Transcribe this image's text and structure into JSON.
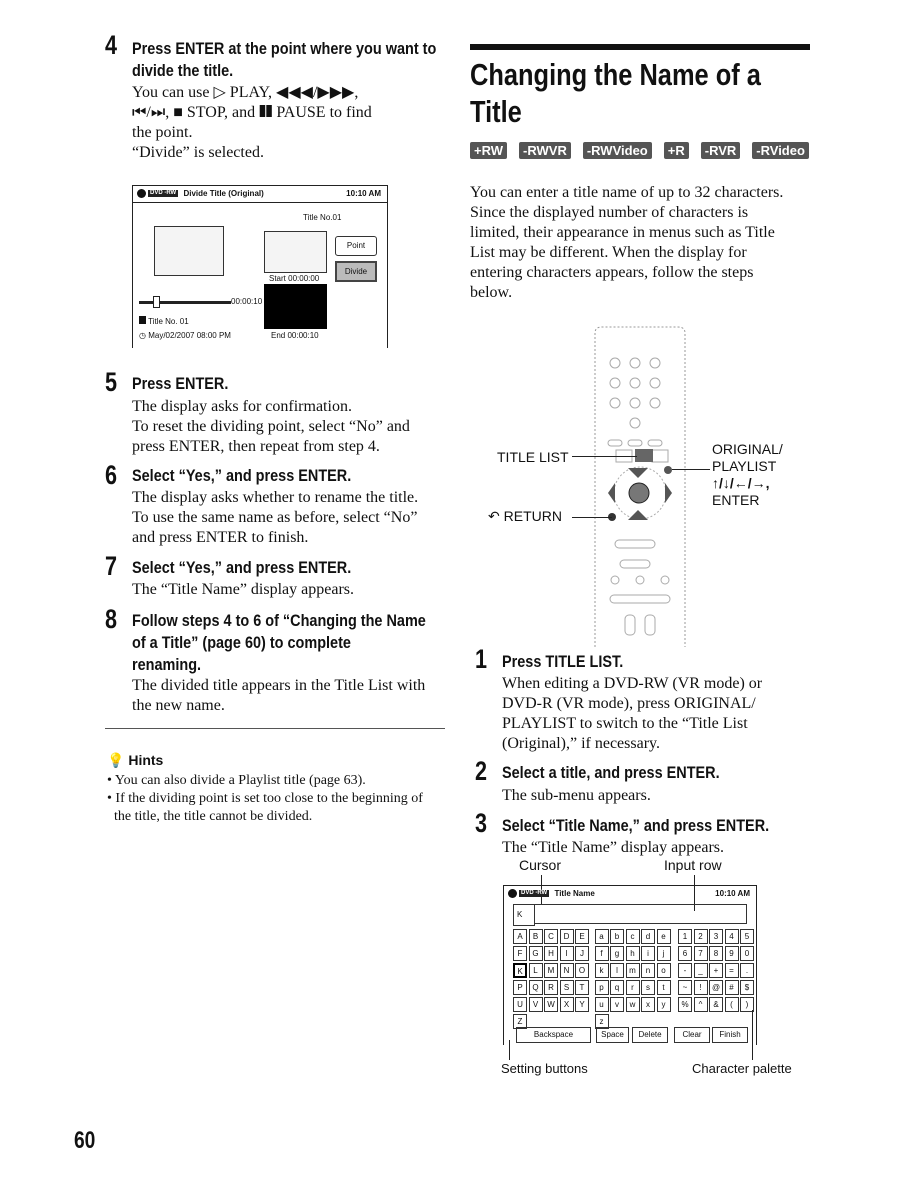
{
  "left": {
    "step4": {
      "num": "4",
      "heading1": "Press ENTER at the point where you want to",
      "heading2": "divide the title.",
      "body1": "You can use ▷ PLAY, ◀◀◀/▶▶▶,",
      "body2": "⏮/⏭, ■ STOP, and ❚❚ PAUSE to find",
      "body3": "the point.",
      "body4": "“Divide” is selected."
    },
    "screen": {
      "title": "Divide Title (Original)",
      "time": "10:10 AM",
      "disc": "DVD -RW",
      "title_no": "Title No.01",
      "point": "Point",
      "divide": "Divide",
      "start": "Start 00:00:00",
      "end": "End  00:00:10",
      "progress_time": "00:00:10",
      "title_label": "Title No. 01",
      "date": "May/02/2007  08:00  PM"
    },
    "step5": {
      "num": "5",
      "heading": "Press ENTER.",
      "body": [
        "The display asks for confirmation.",
        "To reset the dividing point, select “No” and",
        "press ENTER, then repeat from step 4."
      ]
    },
    "step6": {
      "num": "6",
      "heading": "Select “Yes,” and press ENTER.",
      "body": [
        "The display asks whether to rename the title.",
        "To use the same name as before, select “No”",
        "and press ENTER to finish."
      ]
    },
    "step7": {
      "num": "7",
      "heading": "Select “Yes,” and press ENTER.",
      "body": [
        "The “Title Name” display appears."
      ]
    },
    "step8": {
      "num": "8",
      "heading": [
        "Follow steps 4 to 6 of “Changing the Name",
        "of a Title” (page 60) to complete",
        "renaming."
      ],
      "body": [
        "The divided title appears in the Title List with",
        "the new name."
      ]
    },
    "hints": {
      "title": "Hints",
      "items": [
        "• You can also divide a Playlist title (page 63).",
        "• If the dividing point is set too close to the beginning of",
        "  the title, the title cannot be divided."
      ]
    }
  },
  "right": {
    "title1": "Changing the Name of a",
    "title2": "Title",
    "badges": [
      "+RW",
      "-RWVR",
      "-RWVideo",
      "+R",
      "-RVR",
      "-RVideo"
    ],
    "intro": [
      "You can enter a title name of up to 32 characters.",
      "Since the displayed number of characters is",
      "limited, their appearance in menus such as Title",
      "List may be different. When the display for",
      "entering characters appears, follow the steps",
      "below."
    ],
    "remote": {
      "title_list": "TITLE LIST",
      "return": "RETURN",
      "original1": "ORIGINAL/",
      "original2": "PLAYLIST",
      "arrows": "↑/↓/←/→,",
      "enter": "ENTER"
    },
    "step1": {
      "num": "1",
      "heading": "Press TITLE LIST.",
      "body": [
        "When editing a DVD-RW (VR mode) or",
        "DVD-R (VR mode), press ORIGINAL/",
        "PLAYLIST to switch to the “Title List",
        "(Original),” if necessary."
      ]
    },
    "step2": {
      "num": "2",
      "heading": "Select a title, and press ENTER.",
      "body": [
        "The sub-menu appears."
      ]
    },
    "step3": {
      "num": "3",
      "heading": "Select “Title Name,” and press ENTER.",
      "body": [
        "The “Title Name” display appears."
      ]
    },
    "callouts": {
      "cursor": "Cursor",
      "input_row": "Input row",
      "setting": "Setting buttons",
      "palette": "Character palette"
    },
    "screen": {
      "title": "Title Name",
      "time": "10:10 AM",
      "disc": "DVD -RW",
      "input": "K",
      "rows": [
        [
          "A",
          "B",
          "C",
          "D",
          "E",
          "a",
          "b",
          "c",
          "d",
          "e",
          "1",
          "2",
          "3",
          "4",
          "5"
        ],
        [
          "F",
          "G",
          "H",
          "I",
          "J",
          "f",
          "g",
          "h",
          "i",
          "j",
          "6",
          "7",
          "8",
          "9",
          "0"
        ],
        [
          "K",
          "L",
          "M",
          "N",
          "O",
          "k",
          "l",
          "m",
          "n",
          "o",
          "-",
          "_",
          "+",
          "=",
          "."
        ],
        [
          "P",
          "Q",
          "R",
          "S",
          "T",
          "p",
          "q",
          "r",
          "s",
          "t",
          "~",
          "!",
          "@",
          "#",
          "$"
        ],
        [
          "U",
          "V",
          "W",
          "X",
          "Y",
          "u",
          "v",
          "w",
          "x",
          "y",
          "%",
          "^",
          "&",
          "(",
          ")"
        ],
        [
          "Z",
          "",
          "",
          "",
          "",
          "z",
          "",
          "",
          "",
          "",
          "",
          "",
          "",
          "",
          ""
        ]
      ],
      "buttons": [
        "Backspace",
        "Space",
        "Delete",
        "Clear",
        "Finish"
      ]
    }
  },
  "page_number": "60"
}
